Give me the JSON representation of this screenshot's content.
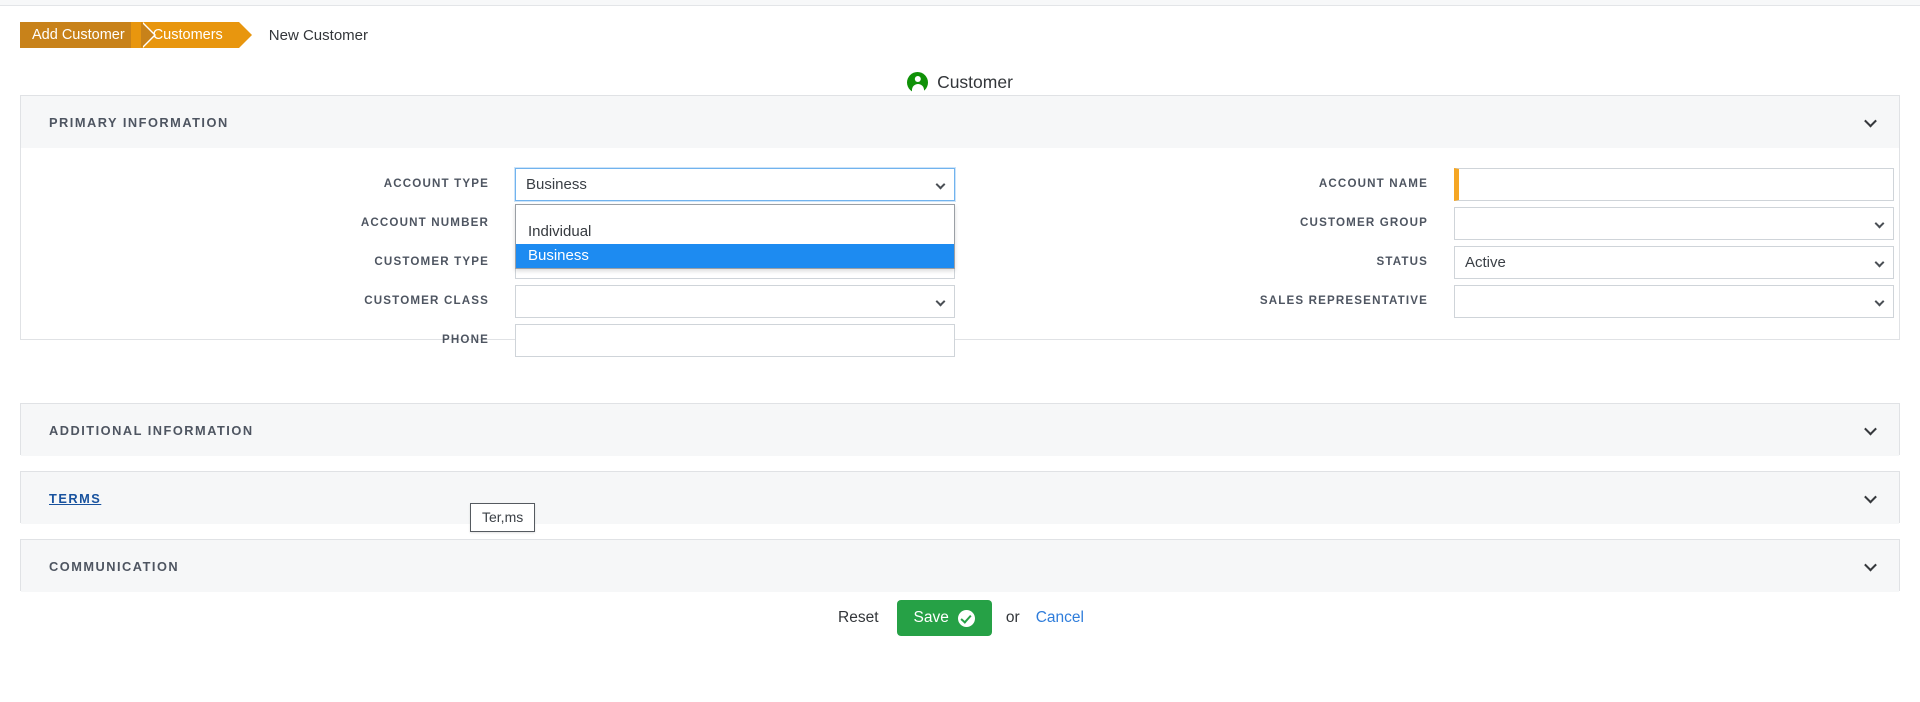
{
  "breadcrumb": {
    "crumb1": "Add Customer",
    "crumb2": "Customers",
    "current": "New Customer"
  },
  "doc": {
    "title": "Customer",
    "icon": "person-icon"
  },
  "sections": {
    "primary": {
      "title": "Primary Information"
    },
    "additional": {
      "title": "Additional Information"
    },
    "terms": {
      "title": "Terms"
    },
    "communication": {
      "title": "Communication"
    }
  },
  "form": {
    "left": [
      {
        "label": "Account Type",
        "value": "Business",
        "type": "select",
        "required": false,
        "open": true
      },
      {
        "label": "Account Number",
        "value": "",
        "type": "text",
        "required": false
      },
      {
        "label": "Customer Type",
        "value": "",
        "type": "select",
        "required": false
      },
      {
        "label": "Customer Class",
        "value": "",
        "type": "select",
        "required": false
      },
      {
        "label": "Phone",
        "value": "",
        "type": "text",
        "required": false
      }
    ],
    "right": [
      {
        "label": "Account Name",
        "value": "",
        "type": "text",
        "required": true
      },
      {
        "label": "Customer Group",
        "value": "",
        "type": "select",
        "required": false
      },
      {
        "label": "Status",
        "value": "Active",
        "type": "select",
        "required": false
      },
      {
        "label": "Sales Representative",
        "value": "",
        "type": "select",
        "required": false
      }
    ]
  },
  "account_type_dropdown": {
    "options": [
      "Individual",
      "Business"
    ],
    "selected": "Business"
  },
  "tooltip": {
    "text": "Ter,ms"
  },
  "actions": {
    "reset": "Reset",
    "save": "Save",
    "or": "or",
    "cancel": "Cancel"
  },
  "colors": {
    "crumb_active": "#c8821a",
    "crumb_next": "#e8960e",
    "required_marker": "#f5a623",
    "save_green": "#26a146",
    "link_blue": "#2f7ddb",
    "option_highlight": "#1d8bf1",
    "person_icon_green": "#0f9107"
  }
}
